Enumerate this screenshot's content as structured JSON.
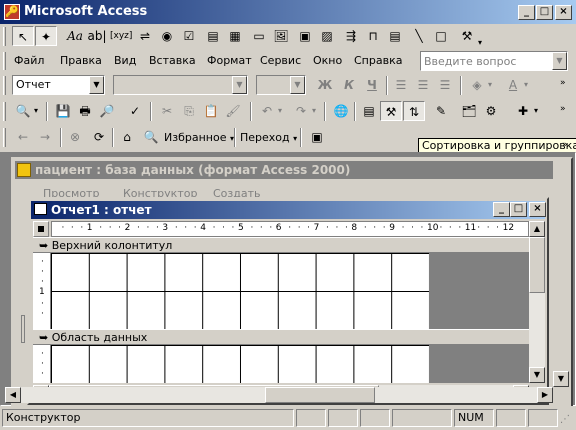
{
  "app": {
    "title": "Microsoft Access"
  },
  "menu": {
    "items": [
      "Файл",
      "Правка",
      "Вид",
      "Вставка",
      "Формат",
      "Сервис",
      "Окно",
      "Справка"
    ],
    "help_placeholder": "Введите вопрос"
  },
  "format_toolbar": {
    "object_combo": "Отчет",
    "font_combo": "",
    "size_combo": "",
    "bold": "Ж",
    "italic": "К",
    "underline": "Ч"
  },
  "web_toolbar": {
    "favorites": "Избранное",
    "goto": "Переход"
  },
  "tooltip": "Сортировка и группировка",
  "db_window": {
    "title": "пациент : база данных (формат Access 2000)",
    "btn_preview": "Просмотр",
    "btn_design": "Конструктор",
    "btn_create": "Создать"
  },
  "report_window": {
    "title": "Отчет1 : отчет",
    "ruler_numbers": [
      "1",
      "2",
      "3",
      "4",
      "5",
      "6",
      "7",
      "8",
      "9",
      "10",
      "11",
      "12"
    ],
    "section_header": "Верхний колонтитул",
    "section_detail": "Область данных",
    "vruler_mark": "1"
  },
  "status": {
    "mode": "Конструктор",
    "num": "NUM"
  },
  "icons": {
    "app": "access-key-icon",
    "close": "×",
    "minimize": "_",
    "maximize": "□"
  }
}
